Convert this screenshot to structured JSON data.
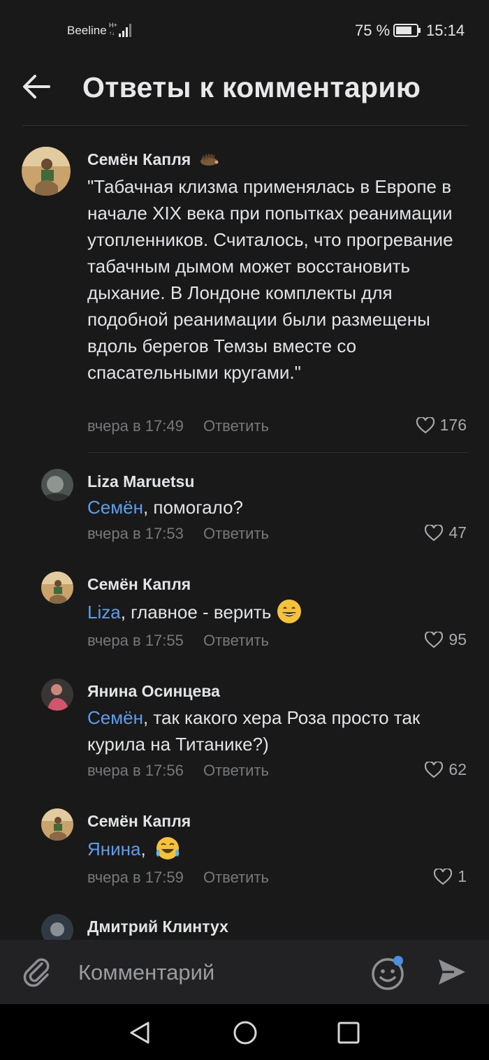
{
  "status": {
    "carrier": "Beeline",
    "battery": "75 %",
    "time": "15:14"
  },
  "header": {
    "title": "Ответы к комментарию"
  },
  "root_comment": {
    "author": "Семён Капля",
    "text": "\"Табачная клизма применялась в Европе в начале XIX века при попытках реанимации утопленников. Считалось, что прогревание табачным дымом может восстановить дыхание. В Лондоне комплекты для подобной реанимации были размещены вдоль берегов Темзы вместе со спасательными кругами.\"",
    "time": "вчера в 17:49",
    "reply": "Ответить",
    "likes": "176"
  },
  "replies": [
    {
      "author": "Liza Maruetsu",
      "mention": "Семён",
      "text": ", помогало?",
      "time": "вчера в 17:53",
      "reply": "Ответить",
      "likes": "47"
    },
    {
      "author": "Семён Капля",
      "mention": "Liza",
      "text": ", главное - верить",
      "time": "вчера в 17:55",
      "reply": "Ответить",
      "likes": "95"
    },
    {
      "author": "Янина Осинцева",
      "mention": "Семён",
      "text": ", так какого хера Роза просто так курила на Титанике?)",
      "time": "вчера в 17:56",
      "reply": "Ответить",
      "likes": "62"
    },
    {
      "author": "Семён Капля",
      "mention": "Янина",
      "text": ",",
      "time": "вчера в 17:59",
      "reply": "Ответить",
      "likes": "1"
    },
    {
      "author": "Дмитрий Клинтух"
    }
  ],
  "composer": {
    "placeholder": "Комментарий"
  },
  "colors": {
    "background": "#19191a",
    "mention": "#5e9de9",
    "emoji_badge": "#4a90e2"
  }
}
